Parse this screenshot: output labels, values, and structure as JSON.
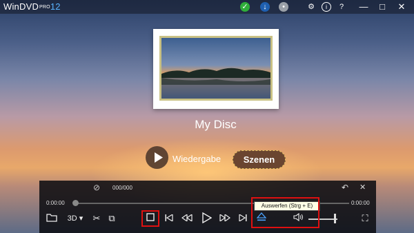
{
  "app": {
    "brand": "WinDVD",
    "pro": "PRO",
    "version": "12"
  },
  "disc": {
    "title": "My Disc"
  },
  "menu": {
    "play_label": "Wiedergabe",
    "scenes_label": "Szenen"
  },
  "panel": {
    "chapter_counter": "000/000",
    "time_elapsed": "0:00:00",
    "time_total": "0:00:00",
    "threed_label": "3D",
    "tooltip": "Auswerfen (Strg + E)",
    "volume_level": 0.9
  },
  "colors": {
    "accent": "#5ab4ff",
    "highlight": "#e01010",
    "scenes_border": "#e0c060"
  },
  "icons": {
    "titlebar": [
      "check-icon",
      "download-icon",
      "chat-icon",
      "gear-icon",
      "info-icon",
      "help-icon",
      "minimize-icon",
      "maximize-icon",
      "close-icon"
    ],
    "controls": [
      "folder-icon",
      "3d-icon",
      "tools-icon",
      "capture-icon",
      "stop-icon",
      "prev-chapter-icon",
      "rewind-icon",
      "play-icon",
      "fast-forward-icon",
      "next-chapter-icon",
      "eject-icon",
      "volume-icon",
      "fullscreen-icon"
    ]
  }
}
